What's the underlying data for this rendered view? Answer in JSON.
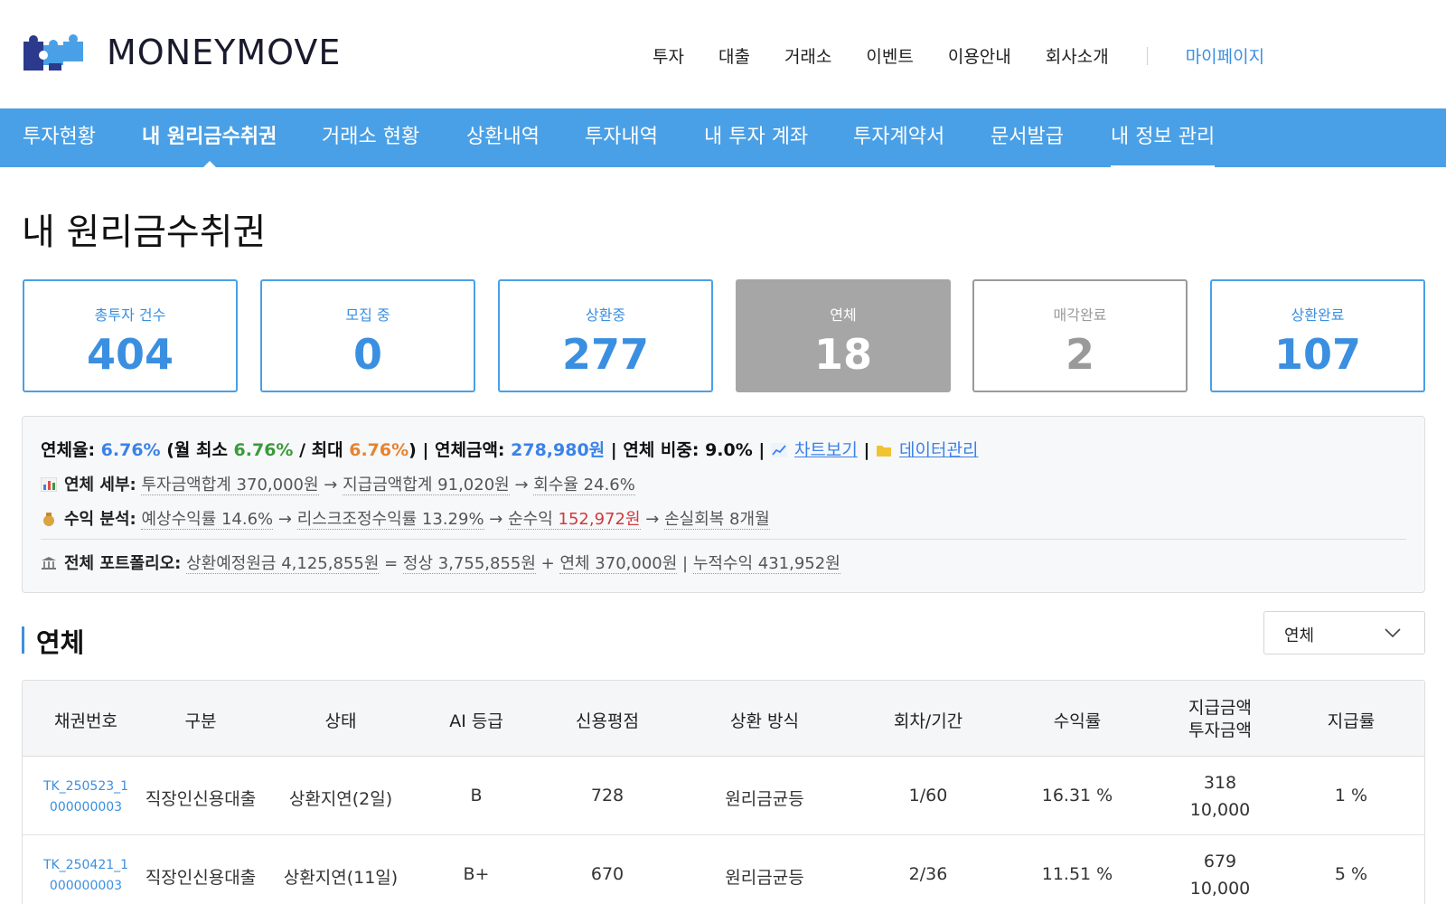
{
  "brand": {
    "name": "MONEYMOVE"
  },
  "top_nav": {
    "items": [
      "투자",
      "대출",
      "거래소",
      "이벤트",
      "이용안내",
      "회사소개"
    ],
    "mypage": "마이페이지"
  },
  "sub_nav": {
    "items": [
      "투자현황",
      "내 원리금수취권",
      "거래소 현황",
      "상환내역",
      "투자내역",
      "내 투자 계좌",
      "투자계약서",
      "문서발급",
      "내 정보 관리"
    ],
    "active": "내 원리금수취권"
  },
  "page": {
    "title": "내 원리금수취권"
  },
  "stats": [
    {
      "label": "총투자 건수",
      "value": "404"
    },
    {
      "label": "모집 중",
      "value": "0"
    },
    {
      "label": "상환중",
      "value": "277"
    },
    {
      "label": "연체",
      "value": "18"
    },
    {
      "label": "매각완료",
      "value": "2"
    },
    {
      "label": "상환완료",
      "value": "107"
    }
  ],
  "summary": {
    "line1": {
      "rate_label": "연체율: ",
      "rate": "6.76%",
      "paren_open": " (월 최소 ",
      "min": "6.76%",
      "slash": " / 최대 ",
      "max": "6.76%",
      "paren_close": ") | ",
      "amount_label": "연체금액: ",
      "amount": "278,980원",
      "ratio": " | 연체 비중: 9.0% | ",
      "chart_link": "차트보기",
      "pipe": " | ",
      "data_link": "데이터관리"
    },
    "detail": {
      "label": "연체 세부:",
      "a": "투자금액합계 370,000원",
      "b": "지급금액합계 91,020원",
      "c": "회수율 24.6%"
    },
    "profit": {
      "label": "수익 분석:",
      "a": "예상수익률 14.6%",
      "b": "리스크조정수익률 13.29%",
      "c_label": "순수익 ",
      "c_value": "152,972원",
      "d": "손실회복 8개월"
    },
    "portfolio": {
      "label": "전체 포트폴리오:",
      "a": "상환예정원금 4,125,855원",
      "eq": " = ",
      "b": "정상 3,755,855원",
      "plus": " + ",
      "c": "연체 370,000원",
      "pipe": " | ",
      "d": "누적수익 431,952원"
    },
    "arrow": "→"
  },
  "section": {
    "title": "연체",
    "filter_value": "연체"
  },
  "table": {
    "headers": {
      "bond_no": "채권번호",
      "type": "구분",
      "status": "상태",
      "ai_grade": "AI 등급",
      "credit": "신용평점",
      "method": "상환 방식",
      "period": "회차/기간",
      "yield": "수익률",
      "paid_line1": "지급금액",
      "paid_line2": "투자금액",
      "pay_rate": "지급률"
    },
    "rows": [
      {
        "id1": "TK_250523_1",
        "id2": "000000003",
        "type": "직장인신용대출",
        "status": "상환지연(2일)",
        "grade": "B",
        "credit": "728",
        "method": "원리금균등",
        "period": "1/60",
        "yield": "16.31 %",
        "paid": "318",
        "invest": "10,000",
        "rate": "1 %"
      },
      {
        "id1": "TK_250421_1",
        "id2": "000000003",
        "type": "직장인신용대출",
        "status": "상환지연(11일)",
        "grade": "B+",
        "credit": "670",
        "method": "원리금균등",
        "period": "2/36",
        "yield": "11.51 %",
        "paid": "679",
        "invest": "10,000",
        "rate": "5 %"
      }
    ]
  },
  "colors": {
    "accent": "#4aa0e6",
    "link": "#3b82e6",
    "overdue_card": "#a6a6a6"
  }
}
